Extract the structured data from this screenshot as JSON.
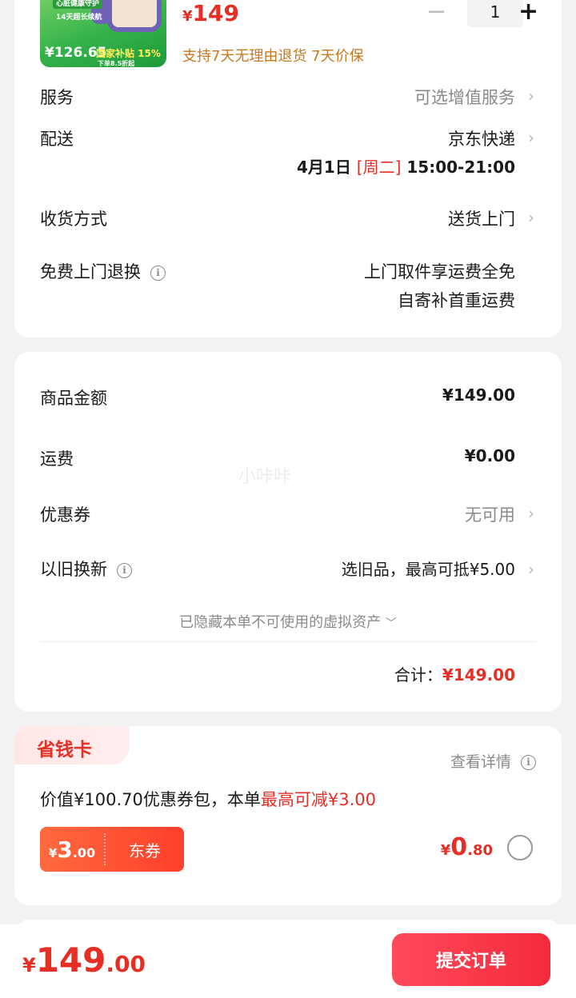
{
  "product": {
    "price_symbol": "¥",
    "price": "149",
    "quantity": "1",
    "policy": "支持7天无理由退货 7天价保",
    "image_tags": [
      "心脏健康守护",
      "14天超长续航"
    ],
    "image_price": "¥126.65",
    "image_subsidy": "国家补贴 15%",
    "image_subsidy_sub": "下单8.5折起"
  },
  "info_rows": {
    "service": {
      "label": "服务",
      "value": "可选增值服务"
    },
    "delivery": {
      "label": "配送",
      "value": "京东快递",
      "date": "4月1日",
      "weekday": "[周二]",
      "time": "15:00-21:00"
    },
    "receive": {
      "label": "收货方式",
      "value": "送货上门"
    },
    "free_return": {
      "label": "免费上门退换",
      "line1": "上门取件享运费全免",
      "line2": "自寄补首重运费"
    }
  },
  "amounts": {
    "goods": {
      "label": "商品金额",
      "value": "¥149.00"
    },
    "shipping": {
      "label": "运费",
      "value": "¥0.00"
    },
    "coupon": {
      "label": "优惠券",
      "value": "无可用"
    },
    "tradein": {
      "label": "以旧换新",
      "value": "选旧品，最高可抵¥5.00"
    },
    "hidden_note": "已隐藏本单不可使用的虚拟资产",
    "total_label": "合计：",
    "total_value": "¥149.00"
  },
  "vip_card": {
    "tab": "省钱卡",
    "details": "查看详情",
    "desc_prefix": "价值¥100.70优惠券包，本单",
    "desc_highlight": "最高可减¥3.00",
    "coupon_symbol": "¥",
    "coupon_int": "3",
    "coupon_dec": ".00",
    "coupon_type": "东券",
    "price_symbol": "¥",
    "price_int": "0",
    "price_dec": ".80"
  },
  "watermark": "小咔咔",
  "footer": {
    "symbol": "¥",
    "int": "149",
    "dec": ".00",
    "submit": "提交订单"
  },
  "colors": {
    "accent": "#e62e24",
    "button": "#f42a3c"
  }
}
